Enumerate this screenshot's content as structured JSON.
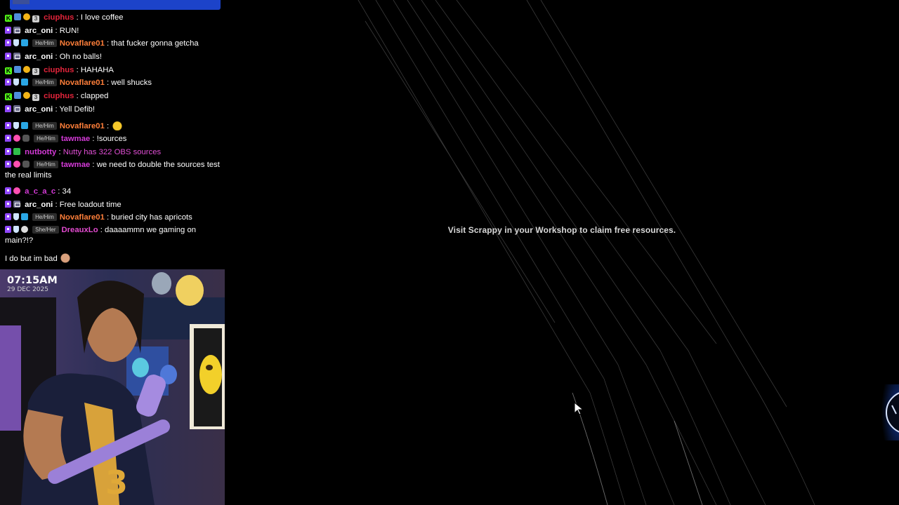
{
  "game": {
    "notice": "Visit Scrappy in your Workshop to claim free resources."
  },
  "chat": {
    "messages": [
      {
        "badges": [
          "kick-icon",
          "rank-icon",
          "coin-icon",
          "sub-3-icon"
        ],
        "user": "ciuphus",
        "text": "I love coffee",
        "user_color": "#e3243b"
      },
      {
        "badges": [
          "twitch-icon",
          "prime-icon"
        ],
        "user": "arc_oni",
        "text": "RUN!",
        "user_color": "#ffffff"
      },
      {
        "badges": [
          "twitch-icon",
          "shield-icon",
          "crown-icon"
        ],
        "pronoun": "He/Him",
        "user": "Novaflare01",
        "text": "that fucker gonna getcha",
        "user_color": "#ff7f3a"
      },
      {
        "badges": [
          "twitch-icon",
          "prime-icon"
        ],
        "user": "arc_oni",
        "text": "Oh no balls!",
        "user_color": "#ffffff"
      },
      {
        "badges": [
          "kick-icon",
          "rank-icon",
          "coin-icon",
          "sub-3-icon"
        ],
        "user": "ciuphus",
        "text": "HAHAHA",
        "user_color": "#e3243b"
      },
      {
        "badges": [
          "twitch-icon",
          "shield-icon",
          "crown-icon"
        ],
        "pronoun": "He/Him",
        "user": "Novaflare01",
        "text": "well shucks",
        "user_color": "#ff7f3a"
      },
      {
        "badges": [
          "kick-icon",
          "rank-icon",
          "coin-icon",
          "sub-3-icon"
        ],
        "user": "ciuphus",
        "text": "clapped",
        "user_color": "#e3243b"
      },
      {
        "badges": [
          "twitch-icon",
          "prime-icon"
        ],
        "user": "arc_oni",
        "text": "Yell Defib!",
        "user_color": "#ffffff"
      },
      {
        "badges": [
          "twitch-icon",
          "shield-icon",
          "crown-icon"
        ],
        "pronoun": "He/Him",
        "user": "Novaflare01",
        "text": "",
        "emote": "coin-emote-icon",
        "user_color": "#ff7f3a"
      },
      {
        "badges": [
          "twitch-icon",
          "heart-icon",
          "mask-icon"
        ],
        "pronoun": "He/Him",
        "user": "tawmae",
        "text": "!sources",
        "user_color": "#d43ad7"
      },
      {
        "badges": [
          "twitch-icon",
          "check-icon"
        ],
        "user": "nutbotty",
        "text": "Nutty has 322 OBS sources",
        "user_color": "#d43ad7",
        "text_color": "#e24fd6"
      },
      {
        "badges": [
          "twitch-icon",
          "heart-icon",
          "mask-icon"
        ],
        "pronoun": "He/Him",
        "user": "tawmae",
        "text": "we need to double the sources test the real limits",
        "user_color": "#d43ad7"
      },
      {
        "badges": [
          "twitch-icon",
          "heart-icon"
        ],
        "user": "a_c_a_c",
        "text": "34",
        "user_color": "#d43ad7"
      },
      {
        "badges": [
          "twitch-icon",
          "prime-icon"
        ],
        "user": "arc_oni",
        "text": "Free loadout time",
        "user_color": "#ffffff"
      },
      {
        "badges": [
          "twitch-icon",
          "shield-icon",
          "crown-icon"
        ],
        "pronoun": "He/Him",
        "user": "Novaflare01",
        "text": "buried city has apricots",
        "user_color": "#ff7f3a"
      },
      {
        "badges": [
          "twitch-icon",
          "shield-icon",
          "face-icon"
        ],
        "pronoun": "She/Her",
        "user": "DreauxLo",
        "text": "daaaammn we gaming on main?!?",
        "user_color": "#e34bd0"
      },
      {
        "badges": [],
        "user": "",
        "text": "I do but im bad",
        "emote": "face-emote-icon",
        "user_color": "#ffffff"
      }
    ]
  },
  "webcam": {
    "time": "07:15AM",
    "date": "29 DEC 2025",
    "jersey_number": "3"
  },
  "colors": {
    "chat_bar": "#1c43c9",
    "twitch": "#9147ff",
    "kick": "#53fc18",
    "edge_widget_glow": "#1b4fd6"
  }
}
